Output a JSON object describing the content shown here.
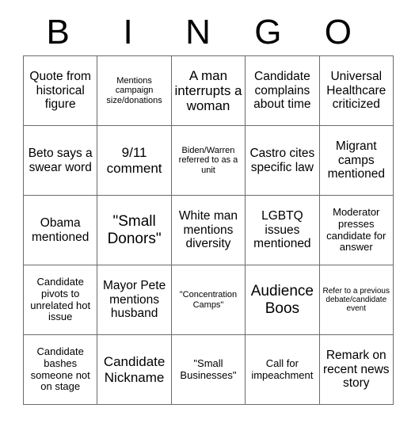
{
  "card": {
    "header_letters": [
      "B",
      "I",
      "N",
      "G",
      "O"
    ],
    "columns": 5,
    "rows": 5,
    "grid_border_color": "#6b6b6b",
    "text_color": "#000000",
    "background_color": "#ffffff",
    "cells": [
      [
        {
          "text": "Quote from historical figure",
          "size": "md"
        },
        {
          "text": "Mentions campaign size/donations",
          "size": "xs"
        },
        {
          "text": "A man interrupts a woman",
          "size": "lg"
        },
        {
          "text": "Candidate complains about time",
          "size": "md"
        },
        {
          "text": "Universal Healthcare criticized",
          "size": "md"
        }
      ],
      [
        {
          "text": "Beto says a swear word",
          "size": "md"
        },
        {
          "text": "9/11 comment",
          "size": "lg"
        },
        {
          "text": "Biden/Warren referred to as a unit",
          "size": "xs"
        },
        {
          "text": "Castro cites specific law",
          "size": "md"
        },
        {
          "text": "Migrant camps mentioned",
          "size": "md"
        }
      ],
      [
        {
          "text": "Obama mentioned",
          "size": "md"
        },
        {
          "text": "\"Small Donors\"",
          "size": "xl"
        },
        {
          "text": "White man mentions diversity",
          "size": "md"
        },
        {
          "text": "LGBTQ issues mentioned",
          "size": "md"
        },
        {
          "text": "Moderator presses candidate for answer",
          "size": "sm"
        }
      ],
      [
        {
          "text": "Candidate pivots to unrelated hot issue",
          "size": "sm"
        },
        {
          "text": "Mayor Pete mentions husband",
          "size": "md"
        },
        {
          "text": "\"Concentration Camps\"",
          "size": "xs"
        },
        {
          "text": "Audience Boos",
          "size": "xl"
        },
        {
          "text": "Refer to a previous debate/candidate event",
          "size": "xxs"
        }
      ],
      [
        {
          "text": "Candidate bashes someone not on stage",
          "size": "sm"
        },
        {
          "text": "Candidate Nickname",
          "size": "lg"
        },
        {
          "text": "\"Small Businesses\"",
          "size": "sm"
        },
        {
          "text": "Call for impeachment",
          "size": "sm"
        },
        {
          "text": "Remark on recent news story",
          "size": "md"
        }
      ]
    ]
  }
}
